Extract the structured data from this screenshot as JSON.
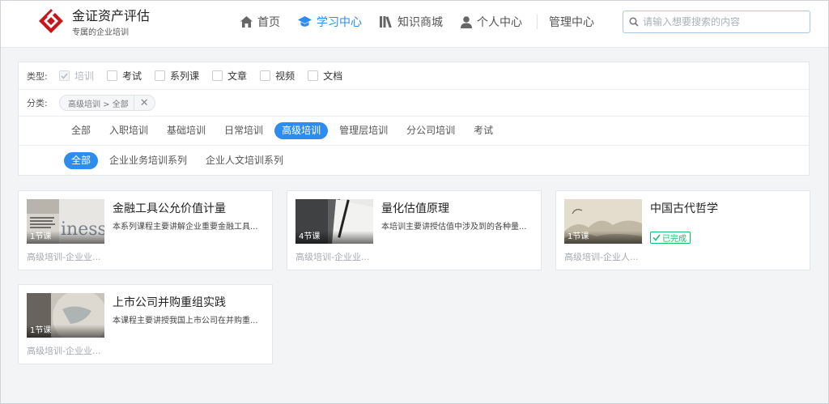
{
  "header": {
    "brand_name": "金证资产评估",
    "brand_slogan": "专属的企业培训",
    "nav": [
      {
        "label": "首页",
        "icon": "home-icon",
        "active": false
      },
      {
        "label": "学习中心",
        "icon": "graduation-cap-icon",
        "active": true
      },
      {
        "label": "知识商城",
        "icon": "books-icon",
        "active": false
      },
      {
        "label": "个人中心",
        "icon": "user-icon",
        "active": false
      },
      {
        "label": "管理中心",
        "icon": "",
        "active": false
      }
    ],
    "search_placeholder": "请输入想要搜索的内容"
  },
  "filter": {
    "type_label": "类型:",
    "types": [
      {
        "label": "培训",
        "checked": true,
        "disabled": true
      },
      {
        "label": "考试",
        "checked": false,
        "disabled": false
      },
      {
        "label": "系列课",
        "checked": false,
        "disabled": false
      },
      {
        "label": "文章",
        "checked": false,
        "disabled": false
      },
      {
        "label": "视频",
        "checked": false,
        "disabled": false
      },
      {
        "label": "文档",
        "checked": false,
        "disabled": false
      }
    ],
    "category_label": "分类:",
    "category_selected": "高级培训 > 全部",
    "category_clear": "✕",
    "level1": [
      "全部",
      "入职培训",
      "基础培训",
      "日常培训",
      "高级培训",
      "管理层培训",
      "分公司培训",
      "考试"
    ],
    "level1_active": "高级培训",
    "level2": [
      "全部",
      "企业业务培训系列",
      "企业人文培训系列"
    ],
    "level2_active": "全部"
  },
  "courses": [
    {
      "title": "金融工具公允价值计量",
      "desc": "本系列课程主要讲解企业重要金融工具...",
      "lessons": "1节课",
      "category": "高级培训-企业业...",
      "status": ""
    },
    {
      "title": "量化估值原理",
      "desc": "本培训主要讲授估值中涉及到的各种量...",
      "lessons": "4节课",
      "category": "高级培训-企业业...",
      "status": ""
    },
    {
      "title": "中国古代哲学",
      "desc": "",
      "lessons": "1节课",
      "category": "高级培训-企业人...",
      "status": "已完成"
    },
    {
      "title": "上市公司并购重组实践",
      "desc": "本课程主要讲授我国上市公司在并购重...",
      "lessons": "1节课",
      "category": "高级培训-企业业...",
      "status": ""
    }
  ],
  "colors": {
    "accent": "#2d8cf0",
    "success": "#19be6b",
    "logo_red": "#c8161d"
  }
}
